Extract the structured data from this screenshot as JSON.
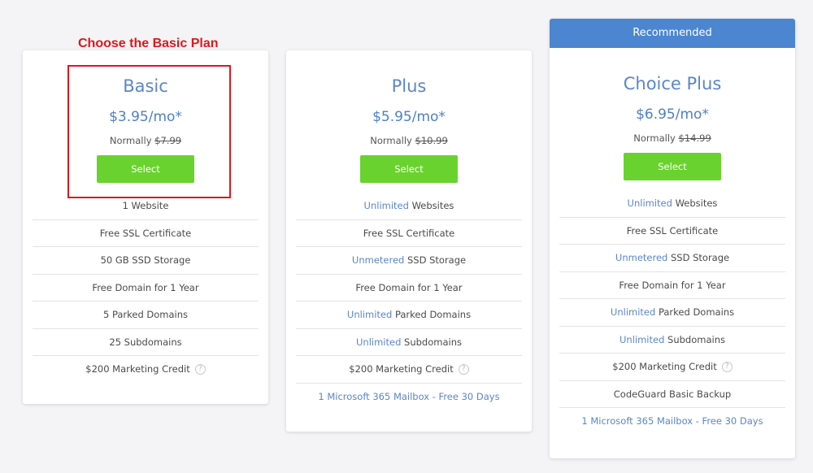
{
  "annotation": {
    "text": "Choose the Basic Plan",
    "color": "#e0161b"
  },
  "colors": {
    "accent": "#4c86d0",
    "button": "#6ad22e",
    "highlight_text": "#5b86c9"
  },
  "plans": [
    {
      "name": "Basic",
      "price": "$3.95/mo*",
      "normally_label": "Normally",
      "normally_price": "$7.99",
      "select_label": "Select",
      "features": [
        {
          "highlight": "",
          "text": "1 Website"
        },
        {
          "highlight": "",
          "text": "Free SSL Certificate"
        },
        {
          "highlight": "",
          "text": "50 GB SSD Storage"
        },
        {
          "highlight": "",
          "text": "Free Domain for 1 Year"
        },
        {
          "highlight": "",
          "text": "5 Parked Domains"
        },
        {
          "highlight": "",
          "text": "25 Subdomains"
        },
        {
          "highlight": "",
          "text": "$200 Marketing Credit",
          "help_icon": "?"
        }
      ]
    },
    {
      "name": "Plus",
      "price": "$5.95/mo*",
      "normally_label": "Normally",
      "normally_price": "$10.99",
      "select_label": "Select",
      "features": [
        {
          "highlight": "Unlimited",
          "text": " Websites"
        },
        {
          "highlight": "",
          "text": "Free SSL Certificate"
        },
        {
          "highlight": "Unmetered",
          "text": " SSD Storage"
        },
        {
          "highlight": "",
          "text": "Free Domain for 1 Year"
        },
        {
          "highlight": "Unlimited",
          "text": " Parked Domains"
        },
        {
          "highlight": "Unlimited",
          "text": " Subdomains"
        },
        {
          "highlight": "",
          "text": "$200 Marketing Credit",
          "help_icon": "?"
        },
        {
          "highlight": "",
          "link": "1 Microsoft 365 Mailbox - Free 30 Days"
        }
      ]
    },
    {
      "name": "Choice Plus",
      "ribbon": "Recommended",
      "price": "$6.95/mo*",
      "normally_label": "Normally",
      "normally_price": "$14.99",
      "select_label": "Select",
      "features": [
        {
          "highlight": "Unlimited",
          "text": " Websites"
        },
        {
          "highlight": "",
          "text": "Free SSL Certificate"
        },
        {
          "highlight": "Unmetered",
          "text": " SSD Storage"
        },
        {
          "highlight": "",
          "text": "Free Domain for 1 Year"
        },
        {
          "highlight": "Unlimited",
          "text": " Parked Domains"
        },
        {
          "highlight": "Unlimited",
          "text": " Subdomains"
        },
        {
          "highlight": "",
          "text": "$200 Marketing Credit",
          "help_icon": "?"
        },
        {
          "highlight": "",
          "text": "CodeGuard Basic Backup"
        },
        {
          "highlight": "",
          "link": "1 Microsoft 365 Mailbox - Free 30 Days"
        }
      ]
    }
  ]
}
